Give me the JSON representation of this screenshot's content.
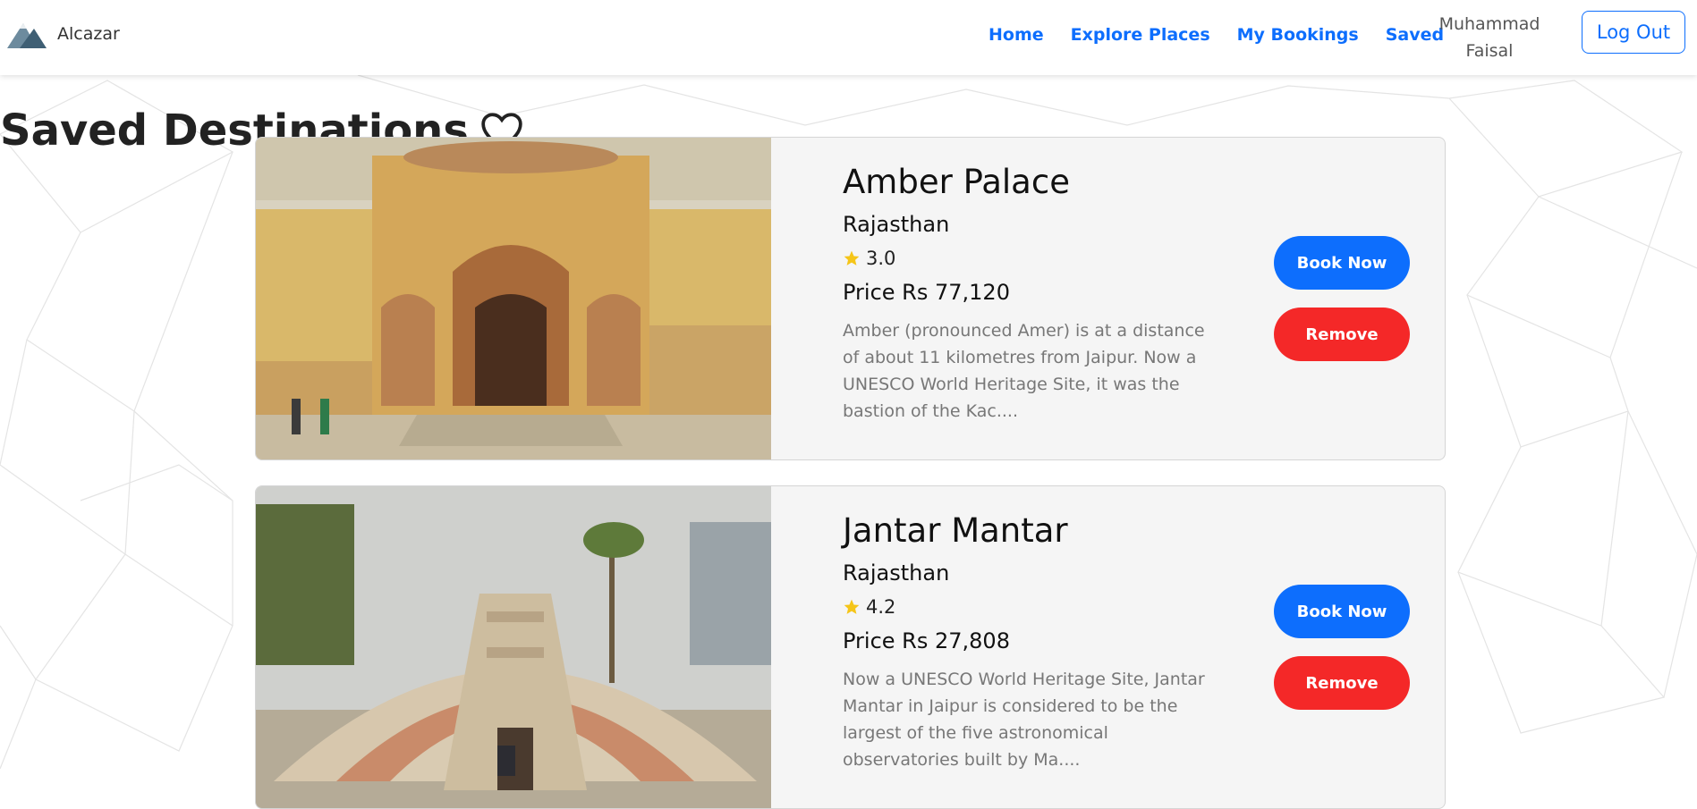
{
  "brand": {
    "name": "Alcazar",
    "icon": "mountain-logo-icon"
  },
  "nav": {
    "links": [
      "Home",
      "Explore Places",
      "My Bookings",
      "Saved"
    ],
    "user_name": "Muhammad Faisal",
    "logout_label": "Log Out"
  },
  "page": {
    "title": "Saved Destinations",
    "title_icon": "heart-outline-icon"
  },
  "destinations": [
    {
      "name": "Amber Palace",
      "state": "Rajasthan",
      "rating": "3.0",
      "price": "Price Rs 77,120",
      "description": "Amber (pronounced Amer) is at a distance of about 11 kilometres from Jaipur. Now a UNESCO World Heritage Site, it was the bastion of the Kac....",
      "book_label": "Book Now",
      "remove_label": "Remove"
    },
    {
      "name": "Jantar Mantar",
      "state": "Rajasthan",
      "rating": "4.2",
      "price": "Price Rs 27,808",
      "description": "Now a UNESCO World Heritage Site, Jantar Mantar in Jaipur is considered to be the largest of the five astronomical observatories built by Ma....",
      "book_label": "Book Now",
      "remove_label": "Remove"
    }
  ],
  "colors": {
    "primary": "#0d6efd",
    "danger": "#f42828",
    "card_bg": "#f5f5f5",
    "star": "#f5c518"
  }
}
